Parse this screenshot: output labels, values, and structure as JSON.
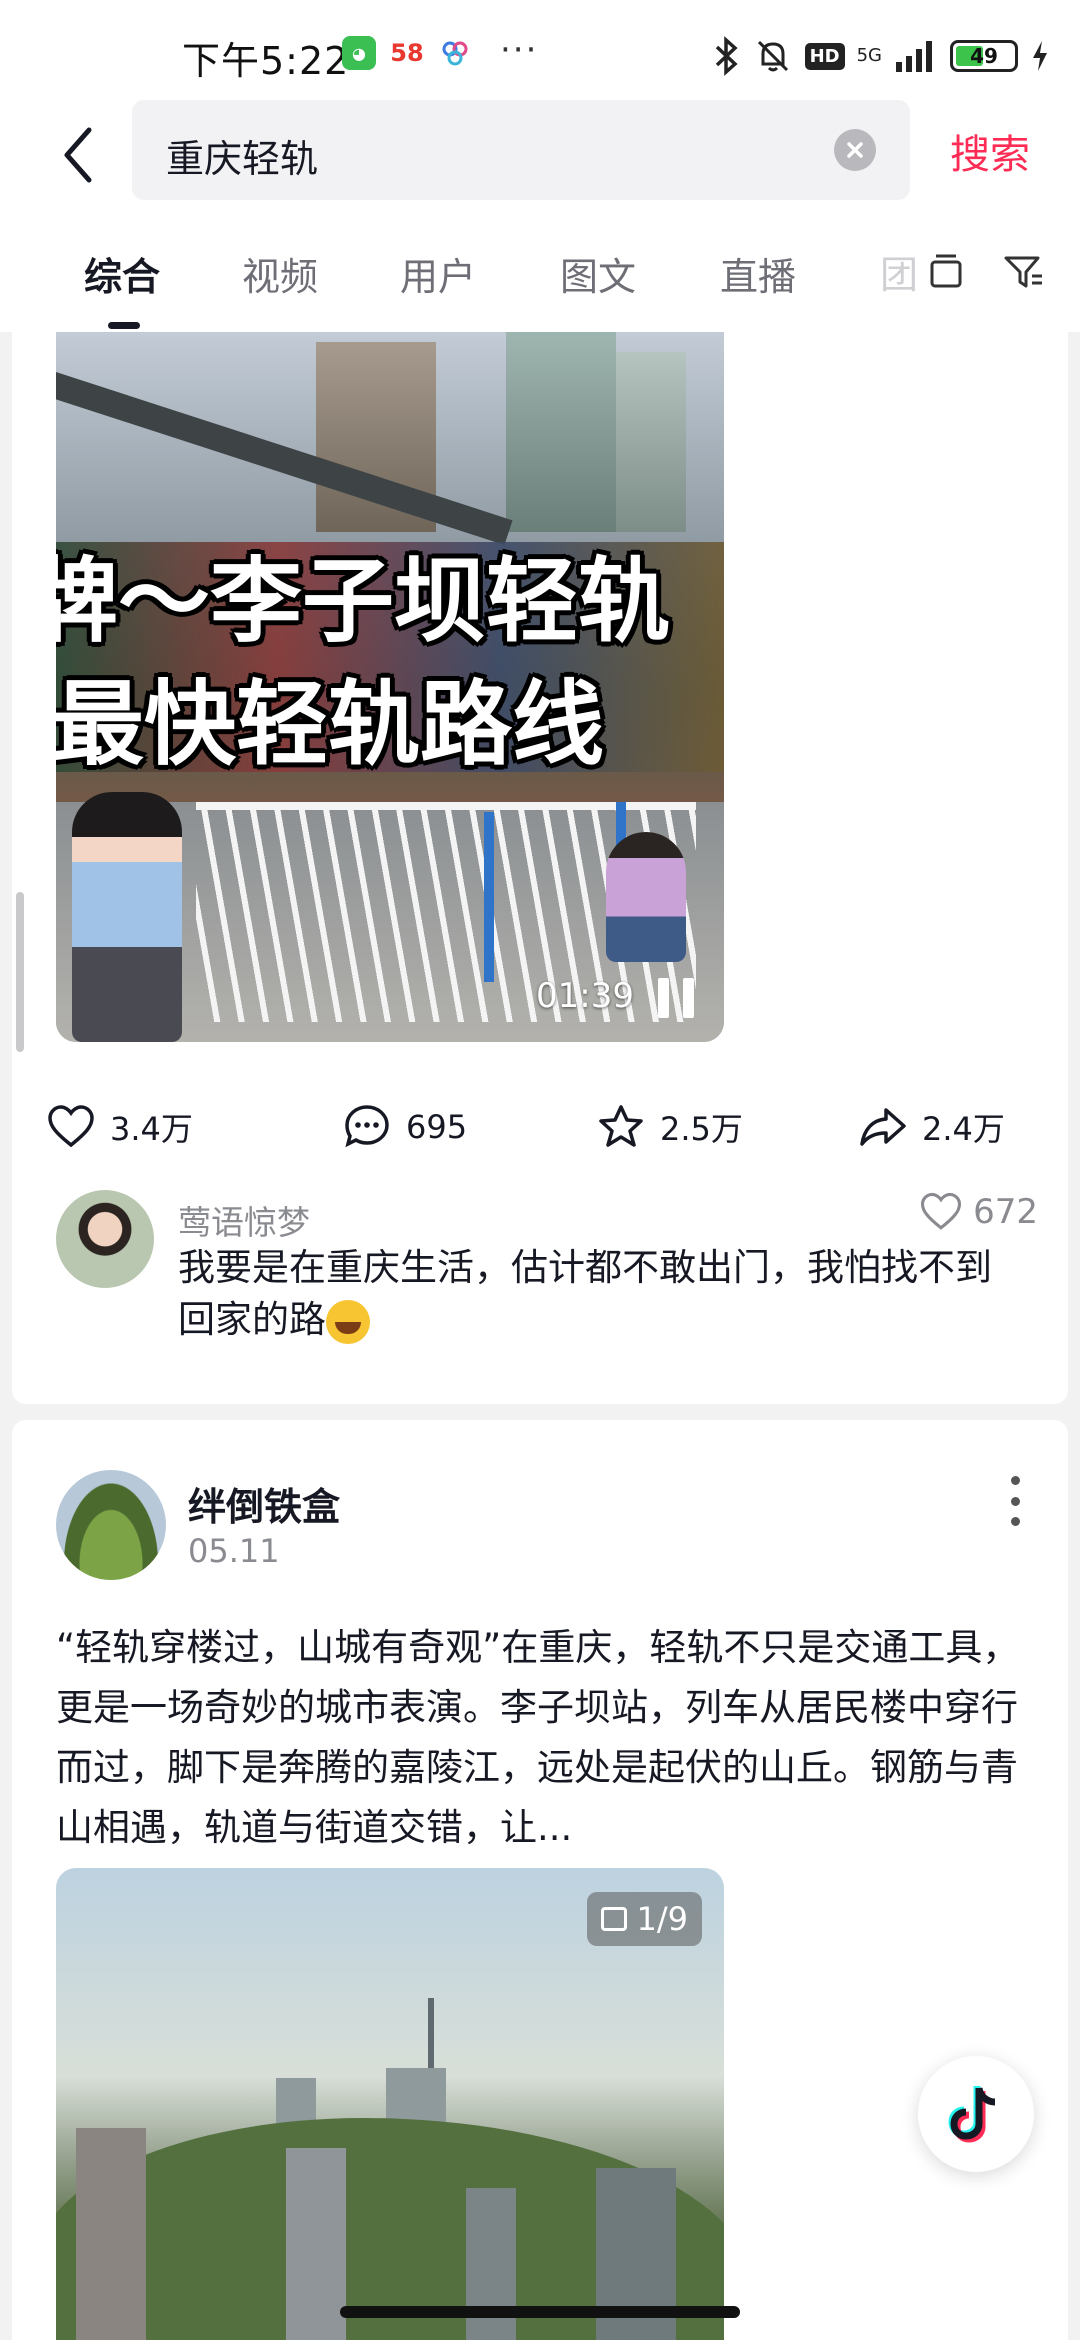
{
  "status_bar": {
    "time": "下午5:22",
    "app_58": "58",
    "more": "···",
    "hd": "HD",
    "network": "5G",
    "battery": "49"
  },
  "search": {
    "query": "重庆轻轨",
    "submit_label": "搜索"
  },
  "tabs": [
    "综合",
    "视频",
    "用户",
    "图文",
    "直播"
  ],
  "tab_overflow": "团",
  "video_post": {
    "caption_line1": "牌～李子坝轻轨",
    "caption_line2": "最快轻轨路线",
    "duration": "01:39",
    "likes": "3.4万",
    "comments": "695",
    "favorites": "2.5万",
    "shares": "2.4万"
  },
  "top_comment": {
    "author": "莺语惊梦",
    "likes": "672",
    "text": "我要是在重庆生活，估计都不敢出门，我怕找不到回家的路"
  },
  "image_post": {
    "author": "绊倒铁盒",
    "date": "05.11",
    "text": "“轻轨穿楼过，山城有奇观”在重庆，轻轨不只是交通工具，更是一场奇妙的城市表演。李子坝站，列车从居民楼中穿行而过，脚下是奔腾的嘉陵江，远处是起伏的山丘。钢筋与青山相遇，轨道与街道交错，让...",
    "photo_counter": "1/9"
  },
  "colors": {
    "accent": "#fe2c55",
    "text_primary": "#161823",
    "text_secondary": "#8a8b91"
  }
}
